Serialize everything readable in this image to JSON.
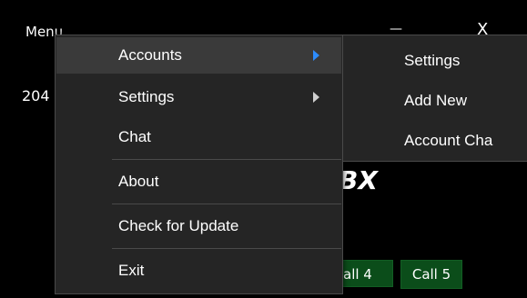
{
  "window": {
    "title": "Menu",
    "minimize_glyph": "—",
    "close_glyph": "X"
  },
  "background": {
    "number_fragment": "204",
    "logo_fragment": "BX",
    "call_buttons": [
      "all 4",
      "Call 5"
    ]
  },
  "menu": {
    "items": [
      {
        "label": "Accounts",
        "has_submenu": true,
        "highlighted": true
      },
      {
        "label": "Settings",
        "has_submenu": true,
        "highlighted": false
      },
      {
        "label": "Chat",
        "has_submenu": false,
        "highlighted": false
      },
      {
        "label": "About",
        "has_submenu": false,
        "highlighted": false
      },
      {
        "label": "Check for Update",
        "has_submenu": false,
        "highlighted": false
      },
      {
        "label": "Exit",
        "has_submenu": false,
        "highlighted": false
      }
    ],
    "submenu_arrow_color": "#2d8cff"
  },
  "submenu": {
    "items": [
      {
        "label": "Settings"
      },
      {
        "label": "Add New"
      },
      {
        "label": "Account Cha"
      }
    ]
  },
  "colors": {
    "background": "#000000",
    "menu_bg": "#252525",
    "highlight_bg": "#3a3a3a",
    "call_button_bg": "#0b4d1a"
  }
}
